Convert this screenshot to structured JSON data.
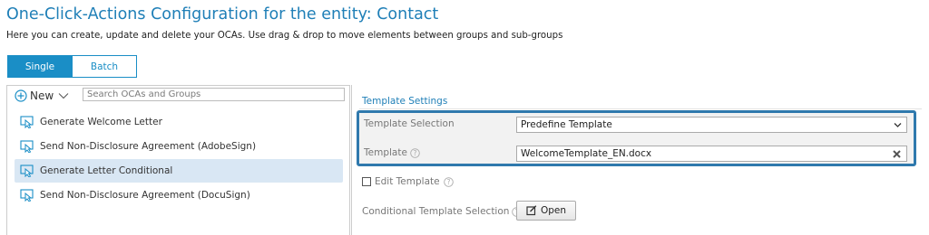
{
  "page": {
    "title": "One-Click-Actions Configuration for the entity: Contact",
    "subtitle": "Here you can create, update and delete your OCAs. Use drag & drop to move elements between groups and sub-groups"
  },
  "mode_toggle": {
    "single_label": "Single",
    "batch_label": "Batch",
    "selected": "Single"
  },
  "toolbar": {
    "new_label": "New",
    "search_placeholder": "Search OCAs and Groups"
  },
  "oca_list": [
    {
      "label": "Generate Welcome Letter",
      "selected": false
    },
    {
      "label": "Send Non-Disclosure Agreement (AdobeSign)",
      "selected": false
    },
    {
      "label": "Generate Letter Conditional",
      "selected": true
    },
    {
      "label": "Send Non-Disclosure Agreement (DocuSign)",
      "selected": false
    }
  ],
  "template_settings": {
    "heading": "Template Settings",
    "template_selection_label": "Template Selection",
    "template_selection_value": "Predefine Template",
    "template_label": "Template",
    "template_value": "WelcomeTemplate_EN.docx",
    "edit_template_label": "Edit Template",
    "edit_template_checked": false,
    "conditional_label": "Conditional Template Selection",
    "open_button_label": "Open"
  },
  "colors": {
    "accent": "#1a8ec6",
    "title": "#1f7fb7",
    "highlight_border": "#2f79ad",
    "selected_row": "#d9e7f4"
  },
  "icons": {
    "new": "plus-circle-icon",
    "dropdown": "chevron-down-icon",
    "oca_item": "cursor-click-icon",
    "help": "question-circle-icon",
    "clear": "close-x-icon",
    "open": "edit-open-icon"
  }
}
